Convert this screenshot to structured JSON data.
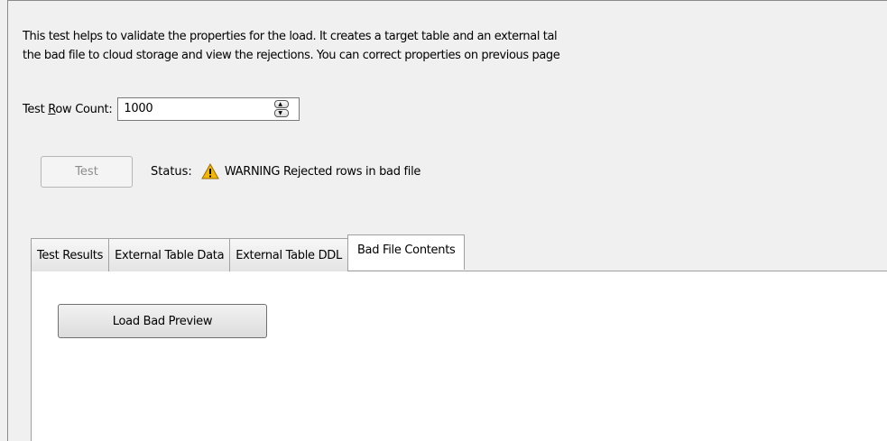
{
  "description": {
    "line1": "This test helps to validate the properties for the load.  It creates a target table and an external tal",
    "line2": "the bad file to cloud storage and view the rejections.  You can correct properties on previous page"
  },
  "row_count": {
    "label_pre": "Test ",
    "label_mnemonic": "R",
    "label_post": "ow Count:",
    "value": "1000"
  },
  "test": {
    "button_label": "Test",
    "status_label": "Status:",
    "status_icon": "warning-triangle-icon",
    "status_text": "WARNING Rejected rows in bad file"
  },
  "tabs": [
    {
      "label": "Test Results",
      "active": false
    },
    {
      "label": "External Table Data",
      "active": false
    },
    {
      "label": "External Table DDL",
      "active": false
    },
    {
      "label": "Bad File Contents",
      "active": true
    }
  ],
  "panel": {
    "load_button_label": "Load Bad Preview"
  },
  "colors": {
    "warning": "#f2b705",
    "window_bg": "#f0f0f0",
    "panel_bg": "#ffffff"
  }
}
